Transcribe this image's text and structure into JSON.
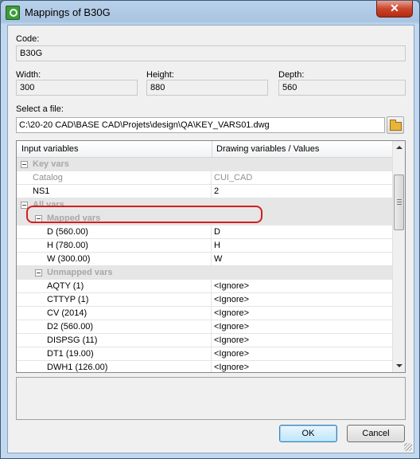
{
  "window": {
    "title": "Mappings of B30G",
    "close_glyph": "✕"
  },
  "code": {
    "label": "Code:",
    "value": "B30G"
  },
  "width": {
    "label": "Width:",
    "value": "300"
  },
  "height": {
    "label": "Height:",
    "value": "880"
  },
  "depth": {
    "label": "Depth:",
    "value": "560"
  },
  "file": {
    "label": "Select a file:",
    "path": "C:\\20-20 CAD\\BASE CAD\\Projets\\design\\QA\\KEY_VARS01.dwg"
  },
  "grid": {
    "header_input": "Input variables",
    "header_drawing": "Drawing variables / Values",
    "key_vars_group": "Key vars",
    "catalog": {
      "name": "Catalog",
      "value": "CUI_CAD"
    },
    "ns1": {
      "name": "NS1",
      "value": "2"
    },
    "all_vars_group": "All vars",
    "mapped_group": "Mapped vars",
    "mapped": [
      {
        "name": "D (560.00)",
        "value": "D"
      },
      {
        "name": "H (780.00)",
        "value": "H"
      },
      {
        "name": "W (300.00)",
        "value": "W"
      }
    ],
    "unmapped_group": "Unmapped vars",
    "unmapped": [
      {
        "name": "AQTY (1)",
        "value": "<Ignore>"
      },
      {
        "name": "CTTYP (1)",
        "value": "<Ignore>"
      },
      {
        "name": "CV (2014)",
        "value": "<Ignore>"
      },
      {
        "name": "D2 (560.00)",
        "value": "<Ignore>"
      },
      {
        "name": "DISPSG (11)",
        "value": "<Ignore>"
      },
      {
        "name": "DT1 (19.00)",
        "value": "<Ignore>"
      },
      {
        "name": "DWH1 (126.00)",
        "value": "<Ignore>"
      }
    ]
  },
  "buttons": {
    "ok": "OK",
    "cancel": "Cancel"
  },
  "colors": {
    "highlight": "#d21f1f",
    "ok_border": "#3c7fb1"
  },
  "icons": [
    "app-icon",
    "close-icon",
    "folder-open-icon",
    "collapse-icon"
  ]
}
